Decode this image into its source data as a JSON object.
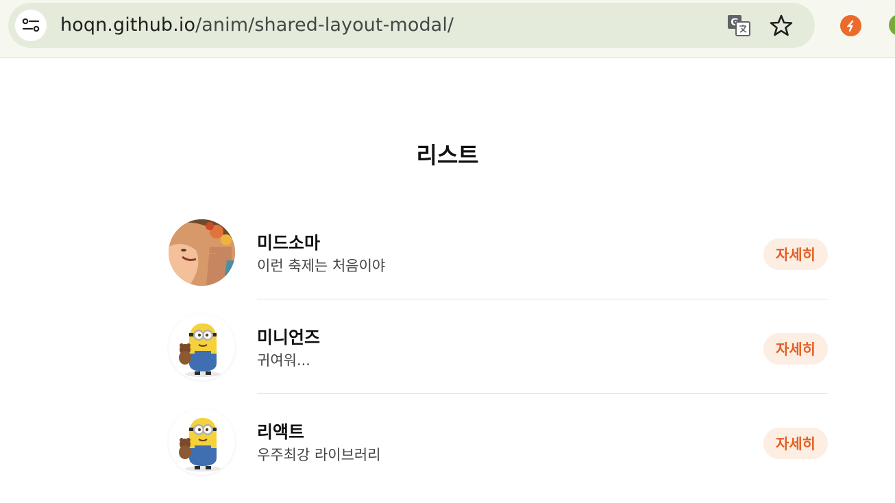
{
  "browser": {
    "url_host": "hoqn.github.io",
    "url_path": "/anim/shared-layout-modal/",
    "icons": [
      "site-settings-icon",
      "translate-icon",
      "bookmark-star-icon",
      "extension-icon"
    ]
  },
  "page": {
    "title": "리스트",
    "items": [
      {
        "title": "미드소마",
        "subtitle": "이런 축제는 처음이야",
        "button": "자세히",
        "avatar": "midsommar-poster"
      },
      {
        "title": "미니언즈",
        "subtitle": "귀여워...",
        "button": "자세히",
        "avatar": "minion"
      },
      {
        "title": "리액트",
        "subtitle": "우주최강 라이브러리",
        "button": "자세히",
        "avatar": "minion"
      }
    ]
  },
  "colors": {
    "accent": "#e45f24",
    "button_bg": "#fdeee3",
    "divider": "#e3e3e3"
  }
}
